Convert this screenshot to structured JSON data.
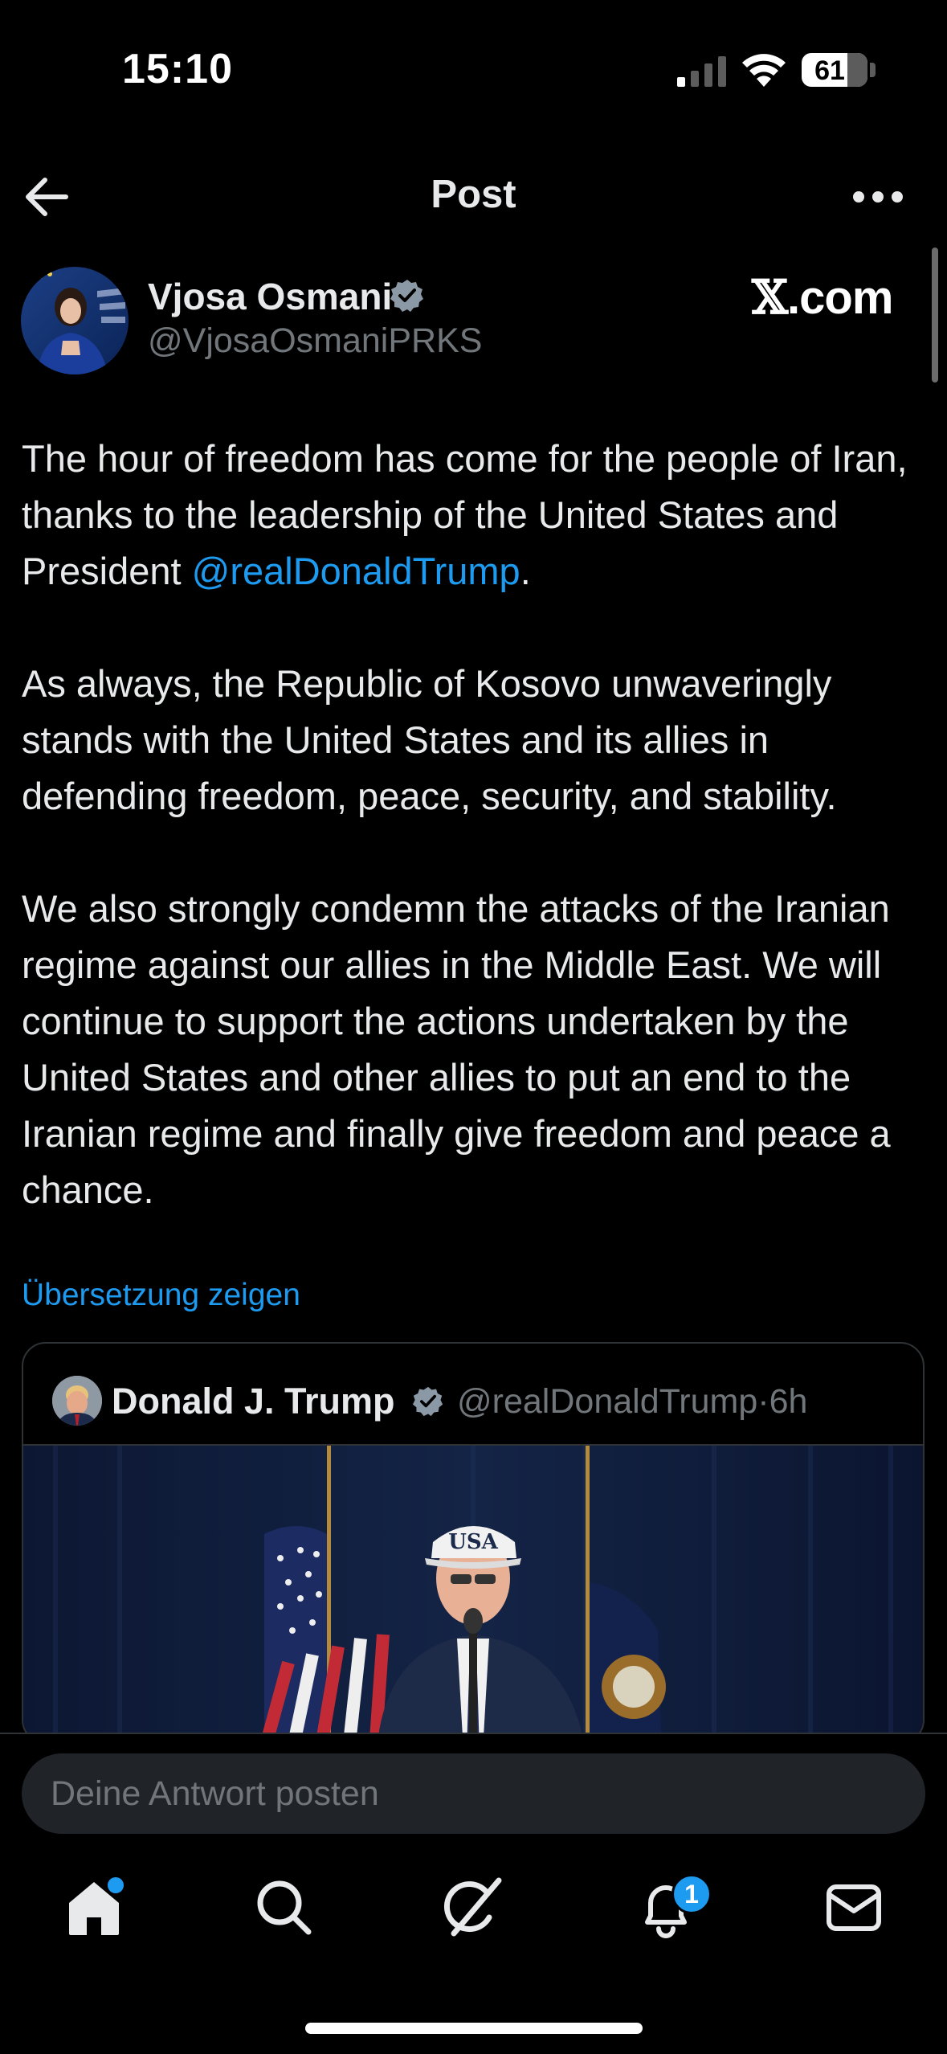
{
  "status_bar": {
    "time": "15:10",
    "battery": "61"
  },
  "header": {
    "title": "Post"
  },
  "author": {
    "name": "Vjosa Osmani",
    "handle": "@VjosaOsmaniPRKS"
  },
  "watermark": {
    "x": "𝕏",
    "domain": ".com"
  },
  "post": {
    "p1_before": "The hour of freedom has come for the people of Iran, thanks to the leadership of the United States and President ",
    "p1_mention": "@realDonaldTrump",
    "p1_after": ".",
    "p2": "As always, the Republic of Kosovo unwaveringly stands with the United States and its allies in defending freedom, peace, security, and stability.",
    "p3": "We also strongly condemn the attacks of the Iranian regime against our allies in the Middle East. We will continue to support the actions undertaken by the United States and other allies to put an end to the Iranian regime and finally give freedom and peace a chance."
  },
  "translate_link": "Übersetzung zeigen",
  "quoted": {
    "name": "Donald J. Trump",
    "handle": "@realDonaldTrump",
    "separator": "·",
    "age": "6h",
    "cap_text": "USA"
  },
  "reply": {
    "placeholder": "Deine Antwort posten"
  },
  "tabbar": {
    "items": [
      "home-icon",
      "search-icon",
      "grok-icon",
      "notifications-icon",
      "messages-icon"
    ],
    "notification_count": "1"
  },
  "colors": {
    "accent": "#1d9bf0",
    "secondary_text": "#71767b",
    "border": "#2f3336"
  }
}
